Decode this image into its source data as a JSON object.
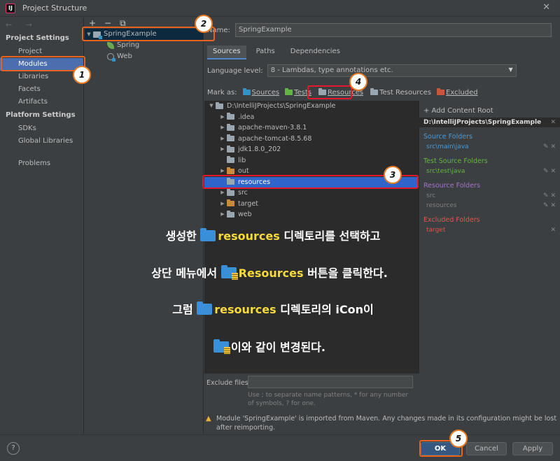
{
  "window": {
    "title": "Project Structure",
    "app_icon": "IJ"
  },
  "nav": {
    "arrows": "← →",
    "project_settings_label": "Project Settings",
    "project_settings": [
      "Project",
      "Modules",
      "Libraries",
      "Facets",
      "Artifacts"
    ],
    "platform_settings_label": "Platform Settings",
    "platform_settings": [
      "SDKs",
      "Global Libraries"
    ],
    "problems": "Problems",
    "selected": "Modules"
  },
  "modules": {
    "toolbar": [
      "+",
      "−",
      "⧉"
    ],
    "root": "SpringExample",
    "children": [
      "Spring",
      "Web"
    ]
  },
  "module_detail": {
    "name_label": "Name:",
    "name_value": "SpringExample",
    "tabs": [
      "Sources",
      "Paths",
      "Dependencies"
    ],
    "active_tab": "Sources",
    "language_level_label": "Language level:",
    "language_level_value": "8 - Lambdas, type annotations etc.",
    "mark_as_label": "Mark as:",
    "mark_as": [
      "Sources",
      "Tests",
      "Resources",
      "Test Resources",
      "Excluded"
    ]
  },
  "tree": {
    "rows": [
      {
        "label": "D:\\IntelliJProjects\\SpringExample",
        "indent": 0,
        "arrow": "▼",
        "folder": "plain"
      },
      {
        "label": ".idea",
        "indent": 1,
        "arrow": "▶",
        "folder": "plain"
      },
      {
        "label": "apache-maven-3.8.1",
        "indent": 1,
        "arrow": "▶",
        "folder": "plain"
      },
      {
        "label": "apache-tomcat-8.5.68",
        "indent": 1,
        "arrow": "▶",
        "folder": "plain"
      },
      {
        "label": "jdk1.8.0_202",
        "indent": 1,
        "arrow": "▶",
        "folder": "plain"
      },
      {
        "label": "lib",
        "indent": 1,
        "arrow": "",
        "folder": "plain"
      },
      {
        "label": "out",
        "indent": 1,
        "arrow": "▶",
        "folder": "orange"
      },
      {
        "label": "resources",
        "indent": 1,
        "arrow": "",
        "folder": "res",
        "selected": true
      },
      {
        "label": "src",
        "indent": 1,
        "arrow": "▶",
        "folder": "plain"
      },
      {
        "label": "target",
        "indent": 1,
        "arrow": "▶",
        "folder": "orange"
      },
      {
        "label": "web",
        "indent": 1,
        "arrow": "▶",
        "folder": "plain"
      }
    ]
  },
  "content_root": {
    "add_label": "+ Add Content Root",
    "path": "D:\\IntelliJProjects\\SpringExample",
    "groups": [
      {
        "title": "Source Folders",
        "color": "blue",
        "entries": [
          "src\\main\\java"
        ]
      },
      {
        "title": "Test Source Folders",
        "color": "green",
        "entries": [
          "src\\test\\java"
        ]
      },
      {
        "title": "Resource Folders",
        "color": "purple",
        "entries": [
          "src",
          "resources"
        ]
      },
      {
        "title": "Excluded Folders",
        "color": "red",
        "entries": [
          "target"
        ]
      }
    ]
  },
  "exclude": {
    "label": "Exclude files:",
    "hint": "Use ; to separate name patterns, * for any number of symbols, ? for one."
  },
  "warning": "Module 'SpringExample' is imported from Maven. Any changes made in its configuration might be lost after reimporting.",
  "footer": {
    "help": "?",
    "ok": "OK",
    "cancel": "Cancel",
    "apply": "Apply"
  },
  "badges": [
    "1",
    "2",
    "3",
    "4",
    "5"
  ],
  "annotation": {
    "line1_pre": "생성한",
    "line1_hl": "resources",
    "line1_post": "디렉토리를 선택하고",
    "line2_pre": "상단 메뉴에서",
    "line2_hl": "Resources",
    "line2_post": "버튼을 클릭한다.",
    "line3_pre": "그럼",
    "line3_hl": "resources",
    "line3_post": "디렉토리의 iCon이",
    "line4": "이와 같이 변경된다."
  },
  "colors": {
    "selection": "#2f65ca",
    "accent": "#4b6eaf",
    "highlight_orange": "#e8641e",
    "highlight_red": "#e5172a",
    "annotation_yellow": "#f7d93a"
  }
}
